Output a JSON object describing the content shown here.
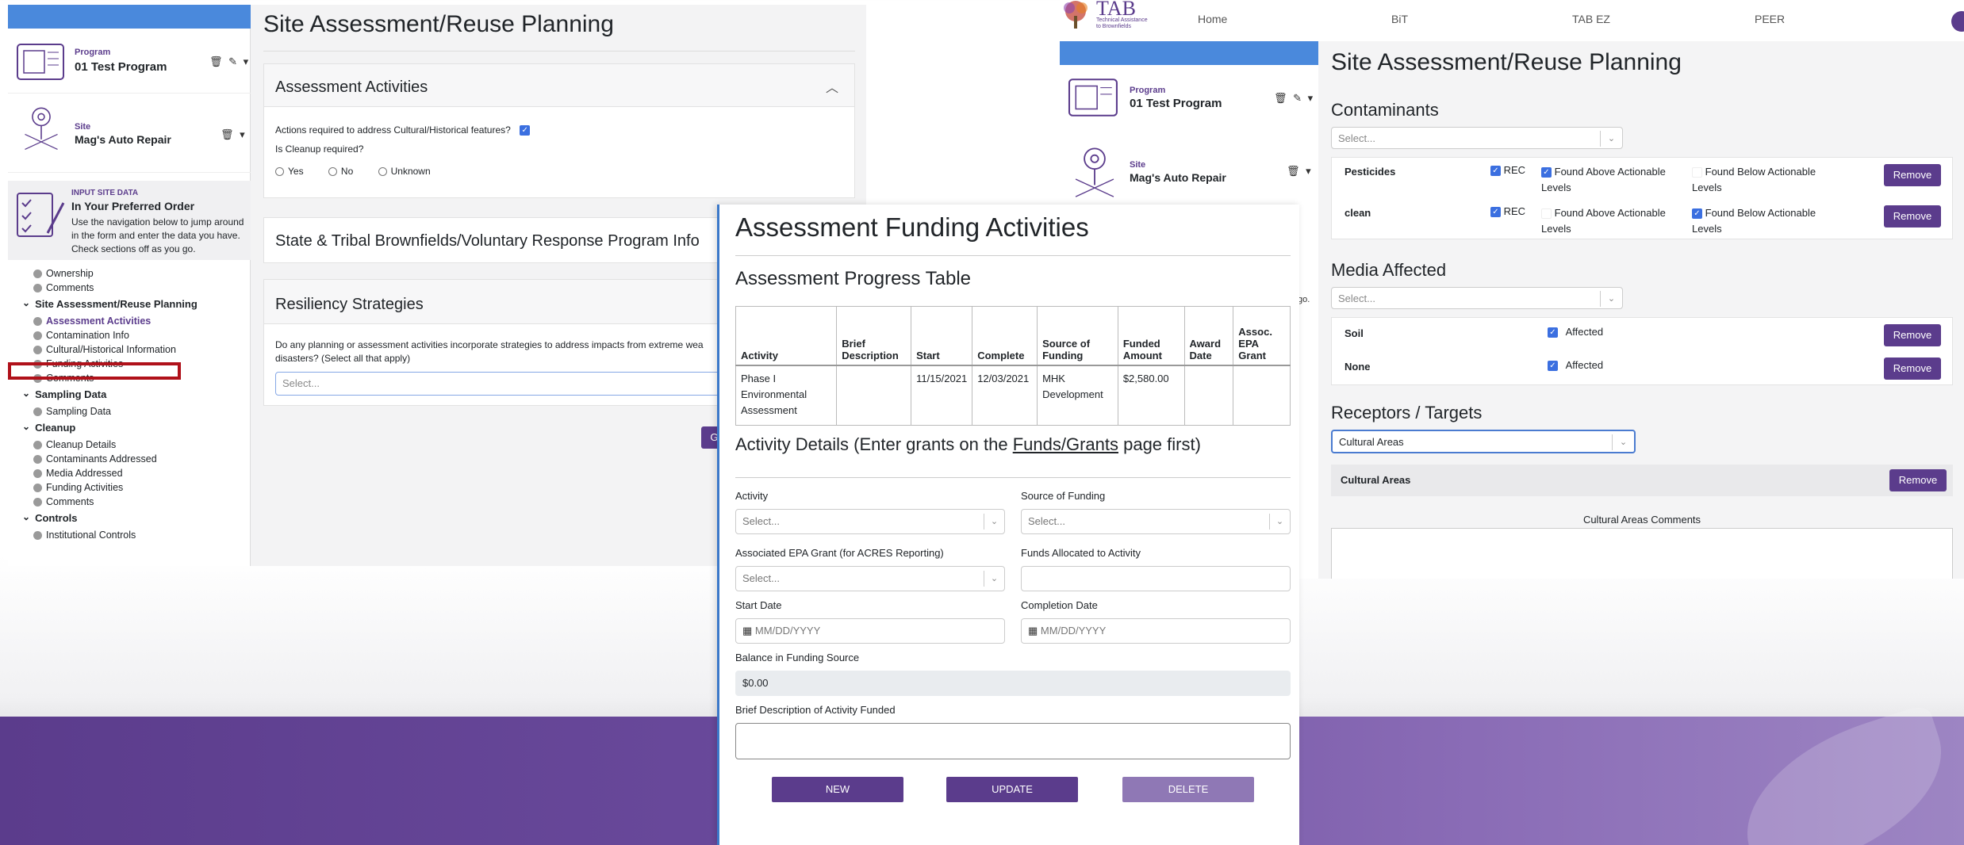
{
  "left": {
    "program_label": "Program",
    "program_name": "01 Test Program",
    "site_label": "Site",
    "site_name": "Mag's Auto Repair",
    "actions_icons": "🗑 ✎ ▾",
    "site_actions": "🗑 ▾",
    "input_heading": "INPUT SITE DATA",
    "input_title": "In Your Preferred Order",
    "input_desc": "Use the navigation below to jump around in the form and enter the data you have. Check sections off as you go.",
    "nav_top_items": [
      "Ownership",
      "Comments"
    ],
    "nav_sections": [
      {
        "title": "Site Assessment/Reuse Planning",
        "items": [
          "Assessment Activities",
          "Contamination Info",
          "Cultural/Historical Information",
          "Funding Activities",
          "Comments"
        ]
      },
      {
        "title": "Sampling Data",
        "items": [
          "Sampling Data"
        ]
      },
      {
        "title": "Cleanup",
        "items": [
          "Cleanup Details",
          "Contaminants Addressed",
          "Media Addressed",
          "Funding Activities",
          "Comments"
        ]
      },
      {
        "title": "Controls",
        "items": [
          "Institutional Controls"
        ]
      }
    ],
    "page_title": "Site Assessment/Reuse Planning",
    "assess_title": "Assessment Activities",
    "q_cultural": "Actions required to address Cultural/Historical features?",
    "q_cleanup": "Is Cleanup required?",
    "opt_yes": "Yes",
    "opt_no": "No",
    "opt_unknown": "Unknown",
    "state_title": "State & Tribal Brownfields/Voluntary Response Program Info",
    "resil_title": "Resiliency Strategies",
    "resil_q": "Do any planning or assessment activities incorporate strategies to address impacts from extreme wea disasters? (Select all that apply)",
    "select_placeholder": "Select...",
    "go_btn": "Go",
    "hidden_text": "go."
  },
  "right": {
    "logo_text": "TAB",
    "logo_sub": "Technical Assistance to Brownfields",
    "nav": [
      "Home",
      "BiT",
      "TAB EZ",
      "PEER"
    ],
    "program_label": "Program",
    "program_name": "01 Test Program",
    "site_label": "Site",
    "site_name": "Mag's Auto Repair",
    "actions_icons": "🗑 ✎ ▾",
    "site_actions": "🗑 ▾",
    "page_title": "Site Assessment/Reuse Planning",
    "contaminants_title": "Contaminants",
    "select_placeholder": "Select...",
    "contaminants": [
      {
        "name": "Pesticides",
        "rec": "REC",
        "above": "Found Above Actionable Levels",
        "below": "Found Below Actionable Levels"
      },
      {
        "name": "clean",
        "rec": "REC",
        "above": "Found Above Actionable Levels",
        "below": "Found Below Actionable Levels"
      }
    ],
    "remove": "Remove",
    "media_title": "Media Affected",
    "media": [
      {
        "name": "Soil",
        "label": "Affected"
      },
      {
        "name": "None",
        "label": "Affected"
      }
    ],
    "receptors_title": "Receptors / Targets",
    "receptor_selected": "Cultural Areas",
    "receptor_row": "Cultural Areas",
    "receptor_comments": "Cultural Areas Comments"
  },
  "front": {
    "title": "Assessment Funding Activities",
    "progress_title": "Assessment Progress Table",
    "table_headers": [
      "Activity",
      "Brief Description",
      "Start",
      "Complete",
      "Source of Funding",
      "Funded Amount",
      "Award Date",
      "Assoc. EPA Grant"
    ],
    "table_row": [
      "Phase I Environmental Assessment",
      "",
      "11/15/2021",
      "12/03/2021",
      "MHK Development",
      "$2,580.00",
      "",
      ""
    ],
    "details_prefix": "Activity Details (Enter grants on the ",
    "details_link": "Funds/Grants",
    "details_suffix": " page first)",
    "activity_label": "Activity",
    "source_label": "Source of Funding",
    "grant_label": "Associated EPA Grant (for ACRES Reporting)",
    "funds_label": "Funds Allocated to Activity",
    "start_label": "Start Date",
    "completion_label": "Completion Date",
    "date_placeholder": "MM/DD/YYYY",
    "select_placeholder": "Select...",
    "balance_label": "Balance in Funding Source",
    "balance_value": "$0.00",
    "brief_label": "Brief Description of Activity Funded",
    "btn_new": "NEW",
    "btn_update": "UPDATE",
    "btn_delete": "DELETE"
  },
  "colors": {
    "brand_purple": "#5b3c8c",
    "header_blue": "#4a89dc",
    "highlight_red": "#b0111a"
  }
}
